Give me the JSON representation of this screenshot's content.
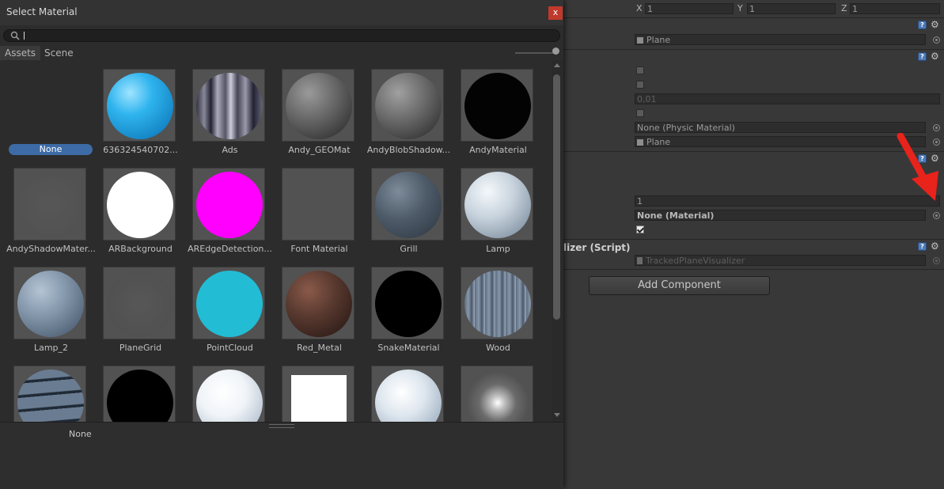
{
  "inspector": {
    "scale": {
      "x_label": "X",
      "x_value": "1",
      "y_label": "Y",
      "y_value": "1",
      "z_label": "Z",
      "z_value": "1"
    },
    "mesh_filter": {
      "mesh_value": "Plane"
    },
    "mesh_collider": {
      "thickness_value": "0,01",
      "material_value": "None (Physic Material)",
      "mesh_value": "Plane"
    },
    "mesh_renderer": {
      "size_value": "1",
      "material_value": "None (Material)"
    },
    "script_component": {
      "title": "lizer (Script)",
      "script_value": "TrackedPlaneVisualizer"
    },
    "add_component_label": "Add Component",
    "arrow_color": "#e8231b"
  },
  "dialog": {
    "title": "Select Material",
    "close_label": "x",
    "search": {
      "value": "",
      "placeholder": ""
    },
    "tabs": [
      "Assets",
      "Scene"
    ],
    "materials": [
      {
        "name": "None",
        "selected": true,
        "swatch": "none"
      },
      {
        "name": "636324540702...",
        "swatch": "cyan-sphere"
      },
      {
        "name": "Ads",
        "swatch": "chrome-sphere"
      },
      {
        "name": "Andy_GEOMat",
        "swatch": "grey-sphere"
      },
      {
        "name": "AndyBlobShadow...",
        "swatch": "grey-sphere-2"
      },
      {
        "name": "AndyMaterial",
        "swatch": "black-sphere"
      },
      {
        "name": "AndyShadowMater...",
        "swatch": "flat-grey"
      },
      {
        "name": "ARBackground",
        "swatch": "white-flat"
      },
      {
        "name": "AREdgeDetection...",
        "swatch": "magenta-flat"
      },
      {
        "name": "Font Material",
        "swatch": "empty-grey"
      },
      {
        "name": "Grill",
        "swatch": "slate-sphere"
      },
      {
        "name": "Lamp",
        "swatch": "marble-sphere"
      },
      {
        "name": "Lamp_2",
        "swatch": "bluegrey-sphere"
      },
      {
        "name": "PlaneGrid",
        "swatch": "faint-sphere"
      },
      {
        "name": "PointCloud",
        "swatch": "teal-flat"
      },
      {
        "name": "Red_Metal",
        "swatch": "brown-sphere"
      },
      {
        "name": "SnakeMaterial",
        "swatch": "black-flat"
      },
      {
        "name": "Wood",
        "swatch": "wood-sphere"
      },
      {
        "name": "",
        "swatch": "stripe-sphere"
      },
      {
        "name": "",
        "swatch": "black-flat-2"
      },
      {
        "name": "",
        "swatch": "white-sphere"
      },
      {
        "name": "",
        "swatch": "white-square"
      },
      {
        "name": "",
        "swatch": "pale-sphere"
      },
      {
        "name": "",
        "swatch": "glow"
      }
    ],
    "preview_name": "None"
  }
}
